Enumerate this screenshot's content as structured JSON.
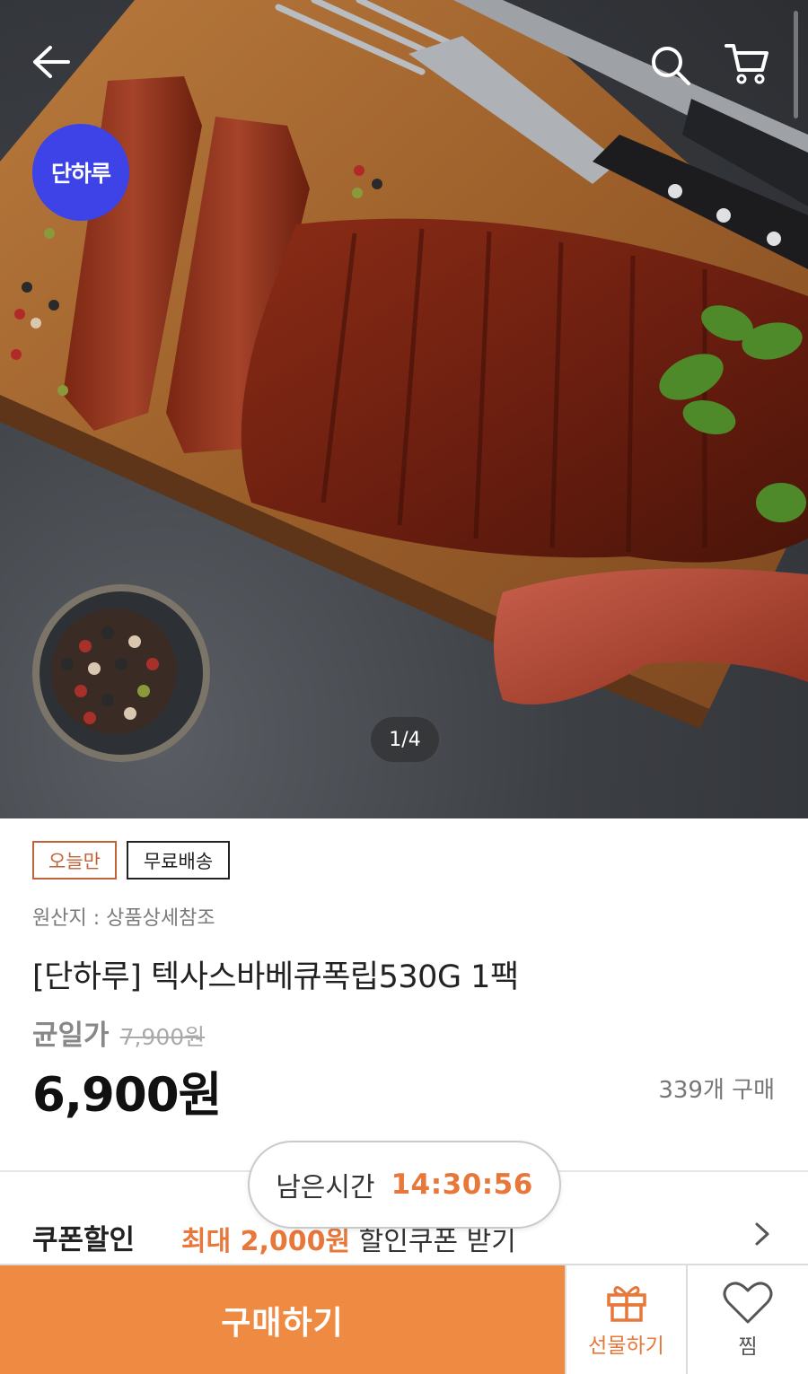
{
  "hero": {
    "brand_badge": "단하루",
    "pager": "1/4"
  },
  "header": {
    "back_icon": "arrow-left-icon",
    "search_icon": "search-icon",
    "cart_icon": "cart-icon"
  },
  "product": {
    "tags": [
      "오늘만",
      "무료배송"
    ],
    "origin": "원산지 : 상품상세참조",
    "title": "[단하루] 텍사스바베큐폭립530G 1팩",
    "avg_label": "균일가",
    "original_price": "7,900원",
    "price": "6,900원",
    "sold_count": "339개 구매"
  },
  "timer": {
    "label": "남은시간",
    "value": "14:30:56"
  },
  "coupon": {
    "label": "쿠폰할인",
    "highlight": "최대 2,000원",
    "text": " 할인쿠폰 받기"
  },
  "actions": {
    "buy_label": "구매하기",
    "gift_label": "선물하기",
    "wish_label": "찜"
  },
  "colors": {
    "accent": "#ef8a42",
    "accent_text": "#e8773a",
    "brand_badge": "#3d43e6",
    "tag_today": "#c0623a"
  }
}
